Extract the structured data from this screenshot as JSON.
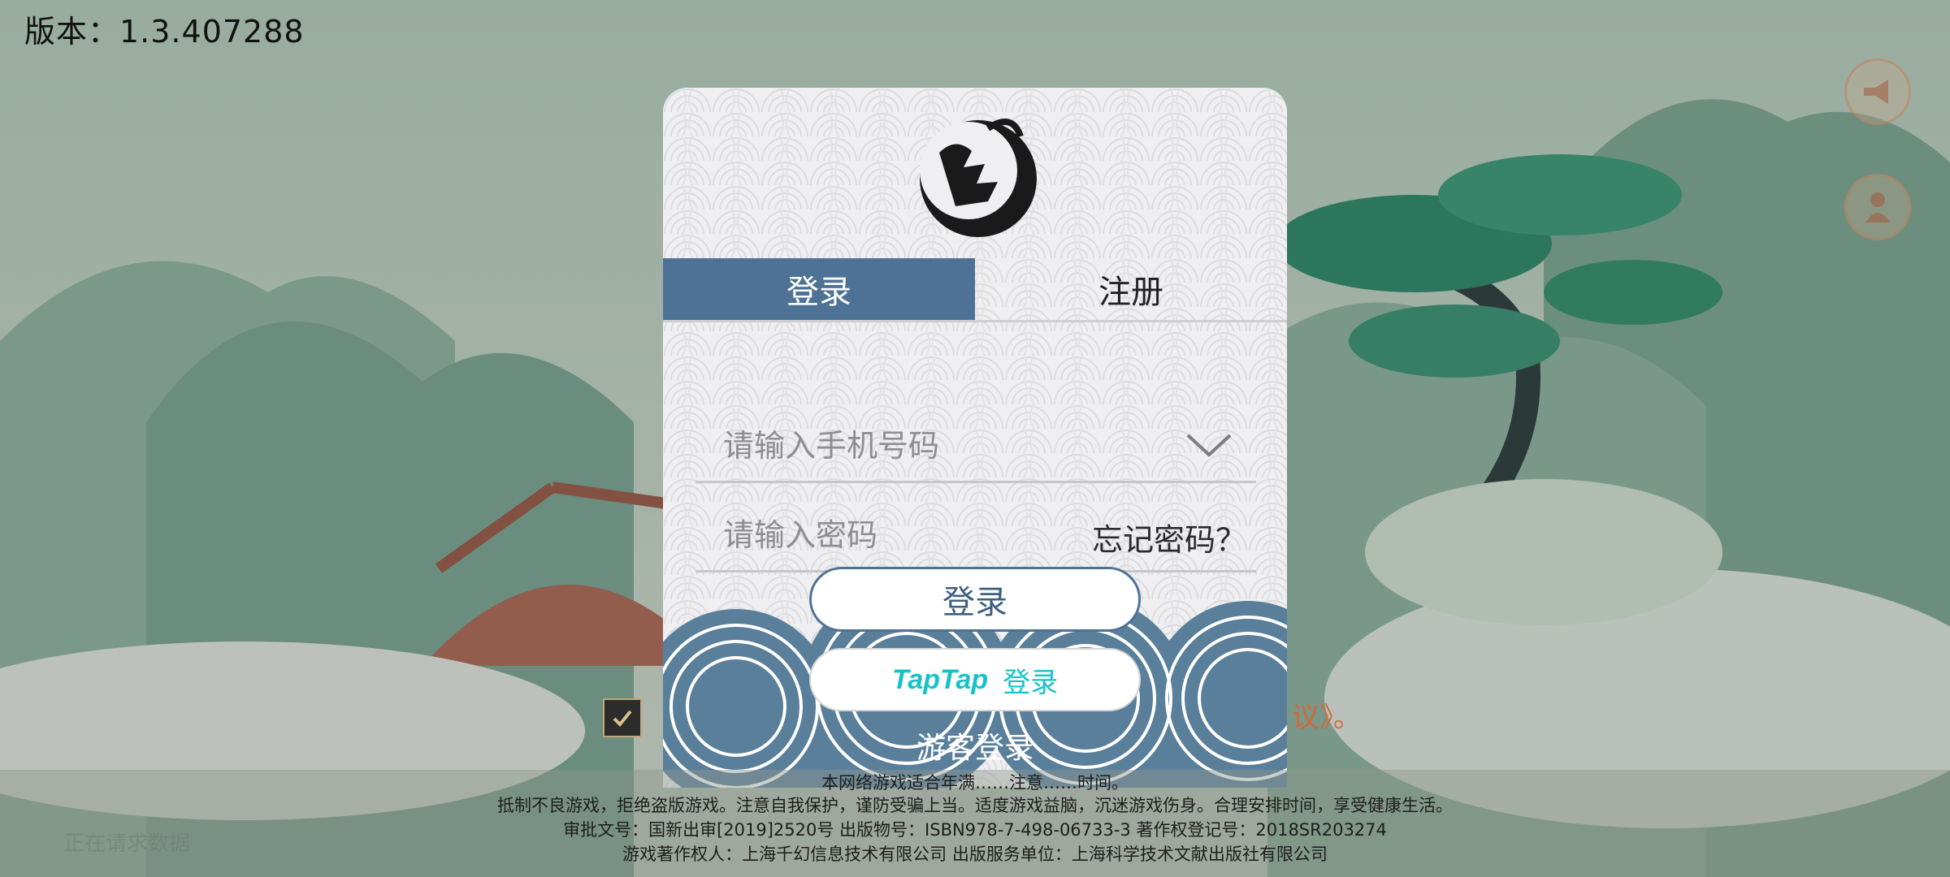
{
  "version_text": "版本：1.3.407288",
  "status_text": "正在请求数据",
  "panel": {
    "logo_alt": "墨魂",
    "tabs": [
      {
        "label": "登录",
        "active": true
      },
      {
        "label": "注册",
        "active": false
      }
    ],
    "phone_placeholder": "请输入手机号码",
    "password_placeholder": "请输入密码",
    "forgot_label": "忘记密码？",
    "login_button": "登录",
    "taptap_logo": "TapTap",
    "taptap_label": "登录",
    "guest_label": "游客登录"
  },
  "agreement": {
    "prefix": "《",
    "tail": "议》。"
  },
  "footer": {
    "line0": "本网络游戏适合年满……注意……时间。",
    "line1": "抵制不良游戏，拒绝盗版游戏。注意自我保护，谨防受骗上当。适度游戏益脑，沉迷游戏伤身。合理安排时间，享受健康生活。",
    "line2": "审批文号：国新出审[2019]2520号  出版物号：ISBN978-7-498-06733-3  著作权登记号：2018SR203274",
    "line3": "游戏著作权人：上海千幻信息技术有限公司  出版服务单位：上海科学技术文献出版社有限公司"
  },
  "colors": {
    "tab_active_bg": "#4d7295",
    "taptap_cyan": "#17c3c7",
    "agreement_accent": "#d2683a"
  }
}
